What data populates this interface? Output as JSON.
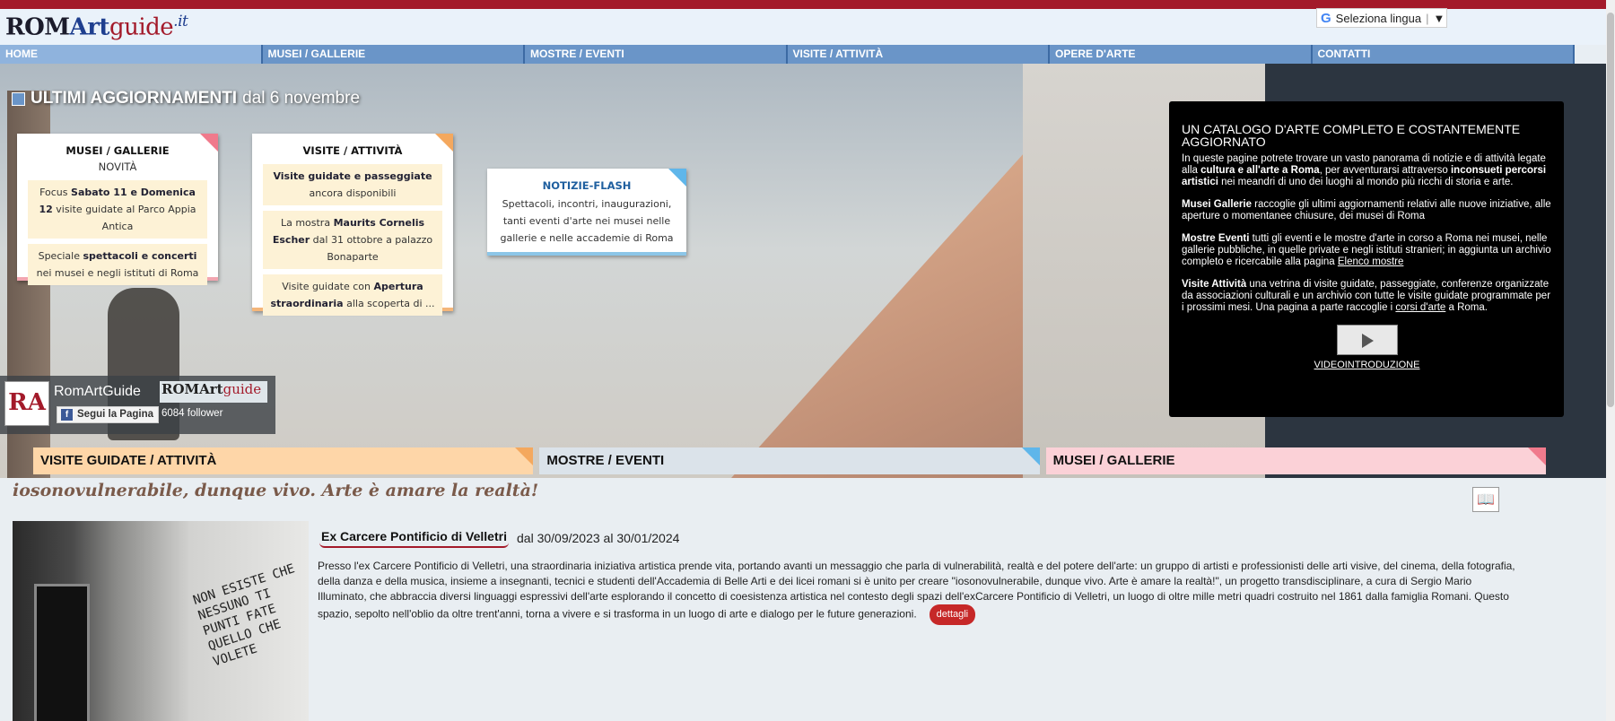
{
  "header": {
    "logo_rom": "ROM",
    "logo_art": "Art",
    "logo_guide": "guide",
    "logo_it": ".it",
    "language_label": "Seleziona lingua"
  },
  "nav": [
    "HOME",
    "MUSEI / GALLERIE",
    "MOSTRE / EVENTI",
    "VISITE / ATTIVITÀ",
    "OPERE D'ARTE",
    "CONTATTI"
  ],
  "hero": {
    "title_bold": "ULTIMI AGGIORNAMENTI",
    "title_rest": " dal 6 novembre"
  },
  "card_musei": {
    "title": "MUSEI / GALLERIE",
    "subtitle": "NOVITÀ",
    "item1_pre": "Focus ",
    "item1_bold": "Sabato 11 e Domenica 12",
    "item1_post": " visite guidate al Parco Appia Antica",
    "item2_pre": "Speciale ",
    "item2_bold": "spettacoli e concerti",
    "item2_post": " nei musei e negli istituti di Roma"
  },
  "card_visite": {
    "title": "VISITE / ATTIVITÀ",
    "item1_bold": "Visite guidate e passeggiate",
    "item1_post": " ancora disponibili",
    "item2_pre": "La mostra ",
    "item2_bold": "Maurits Cornelis Escher",
    "item2_post": " dal 31 ottobre a palazzo Bonaparte",
    "item3_pre": "Visite guidate con ",
    "item3_bold": "Apertura straordinaria",
    "item3_post": " alla scoperta di ..."
  },
  "card_news": {
    "title": "NOTIZIE-FLASH",
    "body": "Spettacoli, incontri, inaugurazioni, tanti eventi d'arte nei musei nelle gallerie e nelle accademie di Roma"
  },
  "facebook": {
    "icon_text": "RA",
    "name": "RomArtGuide",
    "mini_logo_rom": "ROMArt",
    "mini_logo_guide": "guide",
    "like_label": "Segui la Pagina",
    "follower_count": "6084 follower"
  },
  "info": {
    "heading": "UN CATALOGO D'ARTE COMPLETO E COSTANTEMENTE AGGIORNATO",
    "p1_a": "In queste pagine potrete trovare un vasto panorama di notizie e di attività legate alla ",
    "p1_b": "cultura e all'arte a Roma",
    "p1_c": ", per avventurarsi attraverso ",
    "p1_d": "inconsueti percorsi artistici",
    "p1_e": " nei meandri di uno dei luoghi al mondo più ricchi di storia e arte.",
    "p2_a": "Musei Gallerie",
    "p2_b": " raccoglie gli ultimi aggiornamenti relativi alle nuove iniziative, alle aperture o momentanee chiusure, dei musei di Roma",
    "p3_a": "Mostre Eventi",
    "p3_b": " tutti gli eventi e le mostre d'arte in corso a Roma nei musei, nelle gallerie pubbliche, in quelle private e negli istituti stranieri; in aggiunta un archivio completo e ricercabile alla pagina ",
    "p3_link": "Elenco mostre",
    "p4_a": "Visite Attività",
    "p4_b": " una vetrina di visite guidate, passeggiate, conferenze organizzate da associazioni culturali e un archivio con tutte le visite guidate programmate per i prossimi mesi. Una pagina a parte raccoglie i ",
    "p4_link": "corsi d'arte",
    "p4_c": " a Roma.",
    "video_label": "VIDEOINTRODUZIONE"
  },
  "tabs": [
    "VISITE GUIDATE / ATTIVITÀ",
    "MOSTRE / EVENTI",
    "MUSEI / GALLERIE"
  ],
  "article": {
    "tagline": "iosonovulnerabile, dunque vivo. Arte è amare la realtà!",
    "title": "Ex Carcere Pontificio di Velletri",
    "date": "dal 30/09/2023 al 30/01/2024",
    "body": "Presso l'ex Carcere Pontificio di Velletri, una straordinaria iniziativa artistica prende vita, portando avanti un messaggio che parla di vulnerabilità, realtà e del potere dell'arte: un gruppo di artisti e professionisti delle arti visive, del cinema, della fotografia, della danza e della musica, insieme a insegnanti, tecnici e studenti dell'Accademia di Belle Arti e dei licei romani si è unito per creare \"iosonovulnerabile, dunque vivo. Arte è amare la realtà!\", un progetto transdisciplinare, a cura di Sergio Mario Illuminato, che abbraccia diversi linguaggi espressivi dell'arte esplorando il concetto di coesistenza artistica nel contesto degli spazi dell'exCarcere Pontificio di Velletri, un luogo di oltre mille metri quadri costruito nel 1861 dalla famiglia Romani. Questo spazio, sepolto nell'oblio da oltre trent'anni, torna a vivere e si trasforma in un luogo di arte e dialogo per le future generazioni.",
    "details_button": "dettagli",
    "graffiti": "NON ESISTE CHE NESSUNO TI PUNTI FATE QUELLO CHE VOLETE"
  },
  "colors": {
    "brand_red": "#a31a2a",
    "nav_blue": "#6a95c8",
    "tab_orange": "#fed6a8",
    "tab_blue": "#dbe3ea",
    "tab_pink": "#fbd1d7"
  }
}
